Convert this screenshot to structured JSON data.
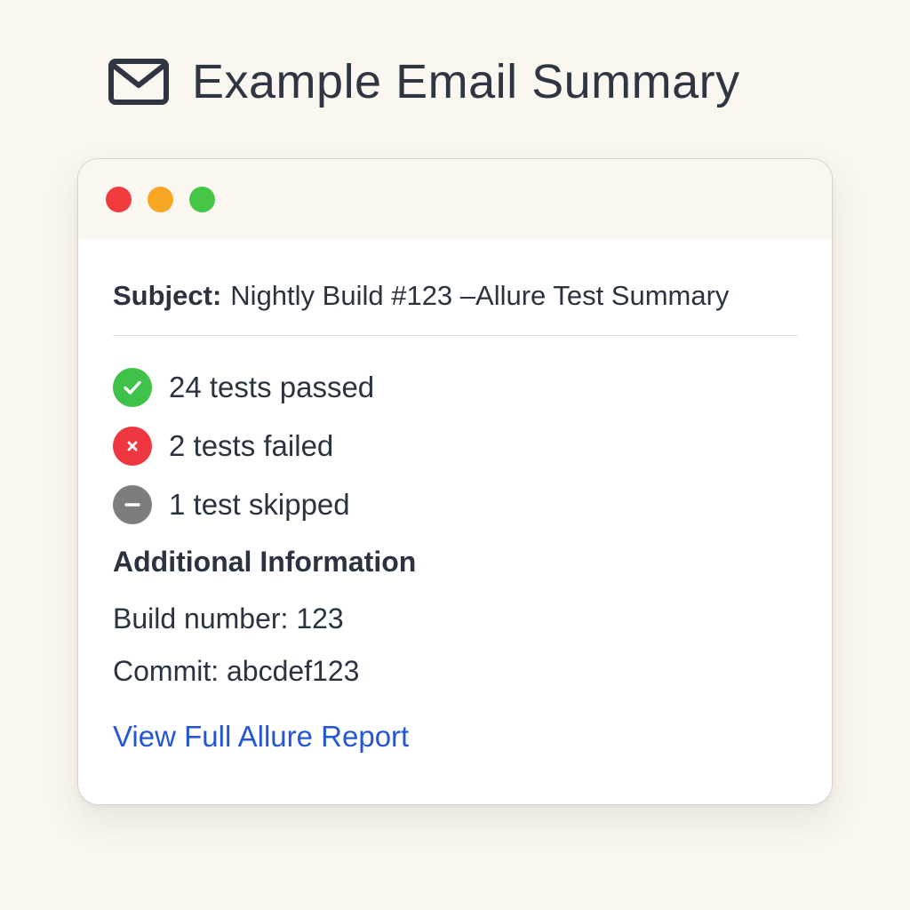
{
  "page": {
    "title": "Example Email Summary",
    "title_icon": "mail-icon"
  },
  "window": {
    "controls": [
      {
        "name": "close",
        "color": "#f23b3f"
      },
      {
        "name": "minimize",
        "color": "#f8a623"
      },
      {
        "name": "maximize",
        "color": "#45c646"
      }
    ]
  },
  "email": {
    "subject_label": "Subject:",
    "subject_value": "Nightly Build #123 –Allure Test Summary",
    "results": [
      {
        "status": "passed",
        "icon": "check-circle-icon",
        "color": "#3fc24a",
        "text": "24 tests passed"
      },
      {
        "status": "failed",
        "icon": "x-circle-icon",
        "color": "#ee3640",
        "text": "2 tests failed"
      },
      {
        "status": "skipped",
        "icon": "minus-circle-icon",
        "color": "#7d7d7d",
        "text": "1 test skipped"
      }
    ],
    "additional_heading": "Additional Information",
    "build_number_line": "Build number: 123",
    "commit_line": "Commit: abcdef123",
    "report_link_text": "View Full Allure Report",
    "link_color": "#2456d6"
  }
}
